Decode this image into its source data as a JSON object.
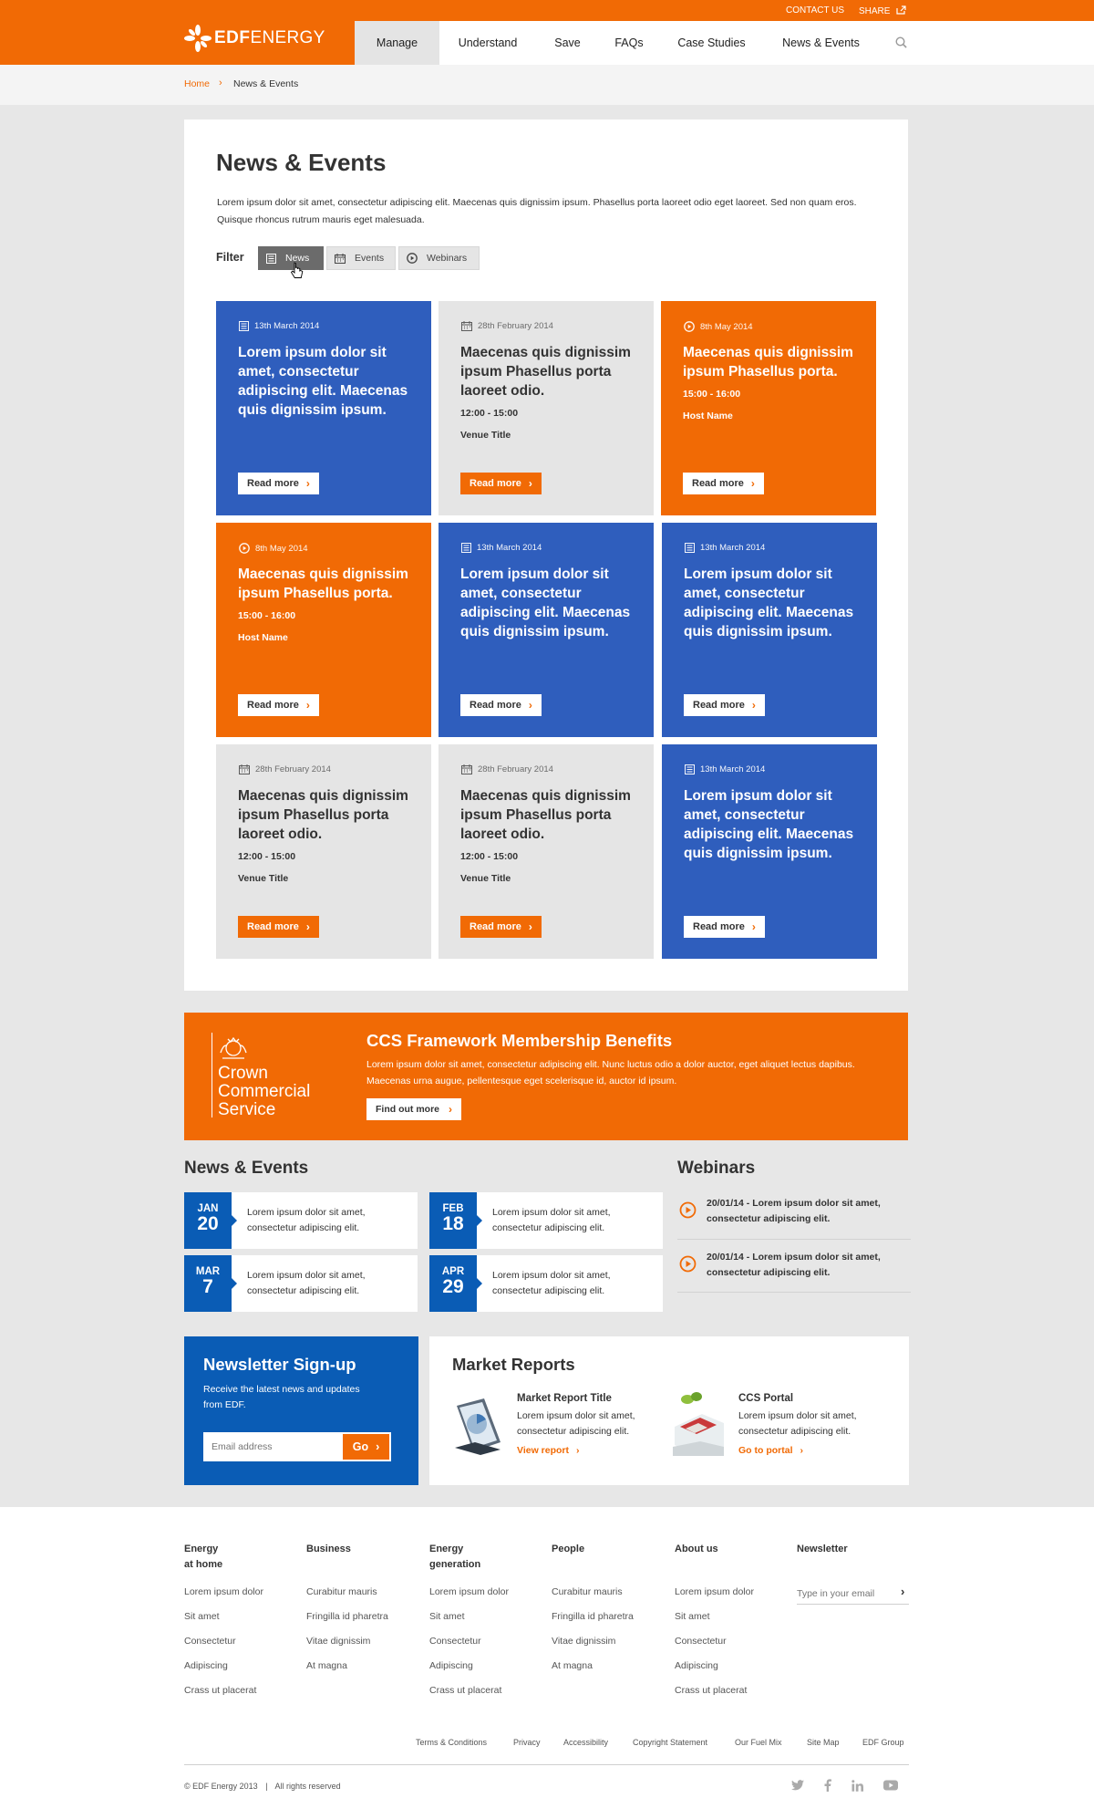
{
  "header": {
    "contact_us": "CONTACT US",
    "share": "SHARE",
    "logo_bold": "edf",
    "logo_light": "ENERGY",
    "nav": [
      "Manage",
      "Understand",
      "Save",
      "FAQs",
      "Case Studies",
      "News & Events"
    ],
    "active_nav": "Manage"
  },
  "breadcrumb": {
    "home": "Home",
    "separator": "›",
    "current": "News & Events"
  },
  "main": {
    "title": "News & Events",
    "intro": "Lorem ipsum dolor sit amet, consectetur adipiscing elit. Maecenas quis dignissim ipsum. Phasellus porta laoreet odio eget laoreet. Sed non quam eros. Quisque rhoncus rutrum mauris eget malesuada.",
    "filter_label": "Filter",
    "filters": [
      "News",
      "Events",
      "Webinars"
    ],
    "active_filter": "News"
  },
  "cards": [
    {
      "color": "blue",
      "icon": "newspaper-icon",
      "date": "13th March 2014",
      "title": "Lorem ipsum dolor sit amet, consectetur adipiscing elit. Maecenas quis dignissim ipsum.",
      "time": "",
      "place": "",
      "cta": "Read more"
    },
    {
      "color": "grey",
      "icon": "calendar-icon",
      "date": "28th February 2014",
      "title": "Maecenas quis dignissim ipsum Phasellus porta laoreet odio.",
      "time": "12:00 - 15:00",
      "place": "Venue Title",
      "cta": "Read more"
    },
    {
      "color": "orange",
      "icon": "play-circle-icon",
      "date": "8th May 2014",
      "title": "Maecenas quis dignissim ipsum Phasellus porta.",
      "time": "15:00 - 16:00",
      "place": "Host Name",
      "cta": "Read more"
    },
    {
      "color": "orange",
      "icon": "play-circle-icon",
      "date": "8th May 2014",
      "title": "Maecenas quis dignissim ipsum Phasellus porta.",
      "time": "15:00 - 16:00",
      "place": "Host Name",
      "cta": "Read more"
    },
    {
      "color": "blue",
      "icon": "newspaper-icon",
      "date": "13th March 2014",
      "title": "Lorem ipsum dolor sit amet, consectetur adipiscing elit. Maecenas quis dignissim ipsum.",
      "time": "",
      "place": "",
      "cta": "Read more"
    },
    {
      "color": "blue",
      "icon": "newspaper-icon",
      "date": "13th March 2014",
      "title": "Lorem ipsum dolor sit amet, consectetur adipiscing elit. Maecenas quis dignissim ipsum.",
      "time": "",
      "place": "",
      "cta": "Read more"
    },
    {
      "color": "grey",
      "icon": "calendar-icon",
      "date": "28th February 2014",
      "title": "Maecenas quis dignissim ipsum Phasellus porta laoreet odio.",
      "time": "12:00 - 15:00",
      "place": "Venue Title",
      "cta": "Read more"
    },
    {
      "color": "grey",
      "icon": "calendar-icon",
      "date": "28th February 2014",
      "title": "Maecenas quis dignissim ipsum Phasellus porta laoreet odio.",
      "time": "12:00 - 15:00",
      "place": "Venue Title",
      "cta": "Read more"
    },
    {
      "color": "blue",
      "icon": "newspaper-icon",
      "date": "13th March 2014",
      "title": "Lorem ipsum dolor sit amet, consectetur adipiscing elit. Maecenas quis dignissim ipsum.",
      "time": "",
      "place": "",
      "cta": "Read more"
    }
  ],
  "ccs": {
    "logo_line1": "Crown",
    "logo_line2": "Commercial",
    "logo_line3": "Service",
    "title": "CCS Framework Membership Benefits",
    "text": "Lorem ipsum dolor sit amet, consectetur adipiscing elit. Nunc luctus odio a dolor auctor, eget aliquet lectus dapibus. Maecenas urna augue, pellentesque eget scelerisque id, auctor id ipsum.",
    "cta": "Find out more"
  },
  "news_events": {
    "title": "News & Events",
    "items": [
      {
        "month": "JAN",
        "day": "20",
        "line1": "Lorem ipsum dolor sit amet,",
        "line2": "consectetur adipiscing elit."
      },
      {
        "month": "FEB",
        "day": "18",
        "line1": "Lorem ipsum dolor sit amet,",
        "line2": "consectetur adipiscing elit."
      },
      {
        "month": "MAR",
        "day": "7",
        "line1": "Lorem ipsum dolor sit amet,",
        "line2": "consectetur adipiscing elit."
      },
      {
        "month": "APR",
        "day": "29",
        "line1": "Lorem ipsum dolor sit amet,",
        "line2": "consectetur adipiscing elit."
      }
    ]
  },
  "webinars": {
    "title": "Webinars",
    "items": [
      {
        "line1": "20/01/14 - Lorem ipsum dolor sit amet,",
        "line2": "consectetur adipiscing elit."
      },
      {
        "line1": "20/01/14 - Lorem ipsum dolor sit amet,",
        "line2": "consectetur adipiscing elit."
      }
    ]
  },
  "newsletter": {
    "title": "Newsletter Sign-up",
    "text_line1": "Receive the latest news and updates",
    "text_line2": "from EDF.",
    "placeholder": "Email address",
    "button": "Go"
  },
  "market_reports": {
    "title": "Market Reports",
    "items": [
      {
        "title": "Market Report Title",
        "line1": "Lorem ipsum dolor sit amet,",
        "line2": "consectetur adipiscing elit.",
        "link": "View report"
      },
      {
        "title": "CCS Portal",
        "line1": "Lorem ipsum dolor sit amet,",
        "line2": "consectetur adipiscing elit.",
        "link": "Go to portal"
      }
    ]
  },
  "footer": {
    "columns": [
      {
        "heading1": "Energy",
        "heading2": "at home",
        "links": [
          "Lorem ipsum dolor",
          "Sit amet",
          "Consectetur",
          "Adipiscing",
          "Crass ut placerat"
        ]
      },
      {
        "heading1": "Business",
        "heading2": "",
        "links": [
          "Curabitur mauris",
          "Fringilla id pharetra",
          "Vitae dignissim",
          "At magna"
        ]
      },
      {
        "heading1": "Energy",
        "heading2": "generation",
        "links": [
          "Lorem ipsum dolor",
          "Sit amet",
          "Consectetur",
          "Adipiscing",
          "Crass ut placerat"
        ]
      },
      {
        "heading1": "People",
        "heading2": "",
        "links": [
          "Curabitur mauris",
          "Fringilla id pharetra",
          "Vitae dignissim",
          "At magna"
        ]
      },
      {
        "heading1": "About us",
        "heading2": "",
        "links": [
          "Lorem ipsum dolor",
          "Sit amet",
          "Consectetur",
          "Adipiscing",
          "Crass ut placerat"
        ]
      }
    ],
    "newsletter_heading": "Newsletter",
    "newsletter_placeholder": "Type in your email",
    "bottom_links": [
      "Terms & Conditions",
      "Privacy",
      "Accessibility",
      "Copyright Statement",
      "Our Fuel Mix",
      "Site Map",
      "EDF Group"
    ],
    "copyright": "© EDF Energy 2013",
    "rights": "All rights reserved",
    "social": [
      "twitter-icon",
      "facebook-icon",
      "linkedin-icon",
      "youtube-icon"
    ]
  },
  "colors": {
    "accent": "#f16a05",
    "blue": "#2f5ebd",
    "dark_blue": "#0a5cb5",
    "grey": "#e5e5e5"
  }
}
